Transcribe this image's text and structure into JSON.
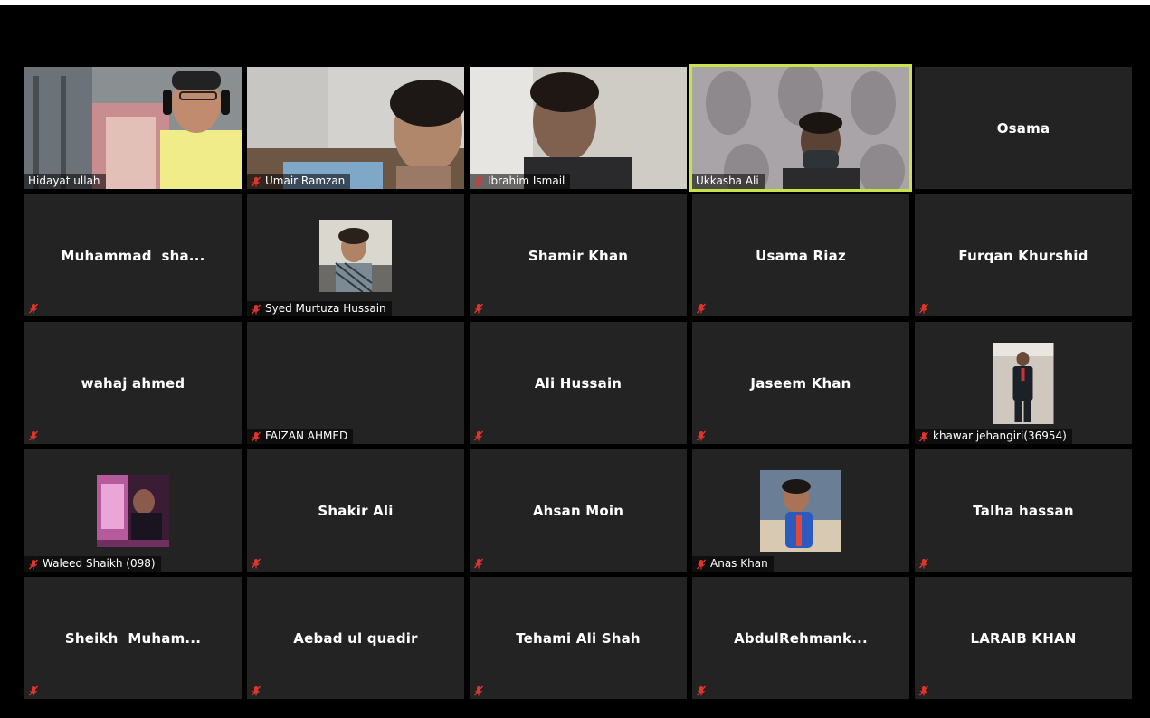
{
  "colors": {
    "background": "#000000",
    "tile": "#232323",
    "active_speaker_border": "#c8e34a",
    "muted_icon": "#e0352b"
  },
  "participants": [
    {
      "name": "Hidayat ullah",
      "mode": "video",
      "muted": false
    },
    {
      "name": "Umair Ramzan",
      "mode": "video",
      "muted": true
    },
    {
      "name": "Ibrahim Ismail",
      "mode": "video",
      "muted": true
    },
    {
      "name": "Ukkasha Ali",
      "mode": "video",
      "muted": false,
      "speaking": true
    },
    {
      "name": "Osama",
      "mode": "name",
      "muted": false
    },
    {
      "name": "Muhammad  sha...",
      "mode": "name",
      "muted": true
    },
    {
      "name": "Syed Murtuza Hussain",
      "mode": "photo",
      "muted": true
    },
    {
      "name": "Shamir Khan",
      "mode": "name",
      "muted": true
    },
    {
      "name": "Usama Riaz",
      "mode": "name",
      "muted": true
    },
    {
      "name": "Furqan Khurshid",
      "mode": "name",
      "muted": true
    },
    {
      "name": "wahaj ahmed",
      "mode": "name",
      "muted": true
    },
    {
      "name": "FAIZAN AHMED",
      "mode": "blank",
      "muted": true
    },
    {
      "name": "Ali Hussain",
      "mode": "name",
      "muted": true
    },
    {
      "name": "Jaseem Khan",
      "mode": "name",
      "muted": true
    },
    {
      "name": "khawar jehangiri(36954)",
      "mode": "photo",
      "muted": true
    },
    {
      "name": "Waleed Shaikh (098)",
      "mode": "photo",
      "muted": true
    },
    {
      "name": "Shakir Ali",
      "mode": "name",
      "muted": true
    },
    {
      "name": "Ahsan Moin",
      "mode": "name",
      "muted": true
    },
    {
      "name": "Anas Khan",
      "mode": "photo",
      "muted": true
    },
    {
      "name": "Talha hassan",
      "mode": "name",
      "muted": true
    },
    {
      "name": "Sheikh  Muham...",
      "mode": "name",
      "muted": true
    },
    {
      "name": "Aebad ul quadir",
      "mode": "name",
      "muted": true
    },
    {
      "name": "Tehami Ali Shah",
      "mode": "name",
      "muted": true
    },
    {
      "name": "AbdulRehmank...",
      "mode": "name",
      "muted": true
    },
    {
      "name": "LARAIB KHAN",
      "mode": "name",
      "muted": true
    }
  ]
}
